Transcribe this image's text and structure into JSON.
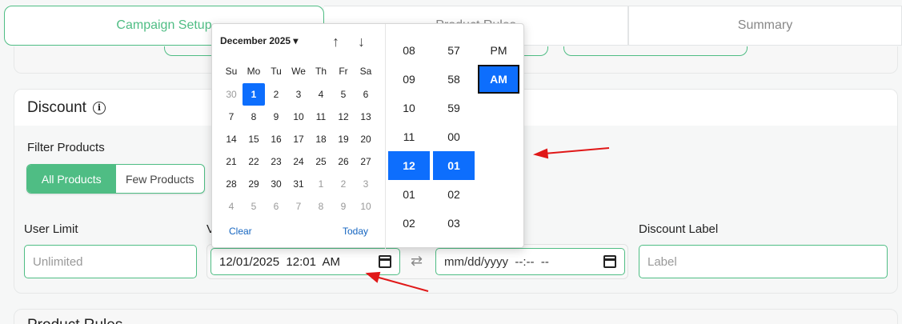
{
  "tabs": [
    "Campaign Setup",
    "Product Rules",
    "Summary"
  ],
  "discount": {
    "title": "Discount",
    "filter_label": "Filter Products",
    "filter_options": [
      "All Products",
      "Few Products"
    ],
    "user_limit_label": "User Limit",
    "user_limit_placeholder": "Unlimited",
    "validity_label": "V",
    "start_value": "12/01/2025  12:01  AM",
    "end_placeholder": "mm/dd/yyyy  --:--  --",
    "discount_label_label": "Discount Label",
    "discount_label_placeholder": "Label"
  },
  "next_section_title": "Product Rules",
  "picker": {
    "month_label": "December 2025",
    "dow": [
      "Su",
      "Mo",
      "Tu",
      "We",
      "Th",
      "Fr",
      "Sa"
    ],
    "weeks": [
      [
        "30",
        "1",
        "2",
        "3",
        "4",
        "5",
        "6"
      ],
      [
        "7",
        "8",
        "9",
        "10",
        "11",
        "12",
        "13"
      ],
      [
        "14",
        "15",
        "16",
        "17",
        "18",
        "19",
        "20"
      ],
      [
        "21",
        "22",
        "23",
        "24",
        "25",
        "26",
        "27"
      ],
      [
        "28",
        "29",
        "30",
        "31",
        "1",
        "2",
        "3"
      ],
      [
        "4",
        "5",
        "6",
        "7",
        "8",
        "9",
        "10"
      ]
    ],
    "selected_day": "1",
    "clear_label": "Clear",
    "today_label": "Today",
    "hours": [
      "08",
      "09",
      "10",
      "11",
      "12",
      "01",
      "02"
    ],
    "selected_hour": "12",
    "minutes": [
      "57",
      "58",
      "59",
      "00",
      "01",
      "02",
      "03"
    ],
    "selected_minute": "01",
    "ampm": [
      "PM",
      "AM"
    ],
    "selected_ampm": "AM"
  },
  "colors": {
    "accent": "#4fbd84",
    "picker_select": "#0d6efd",
    "annotation": "#e01818"
  }
}
